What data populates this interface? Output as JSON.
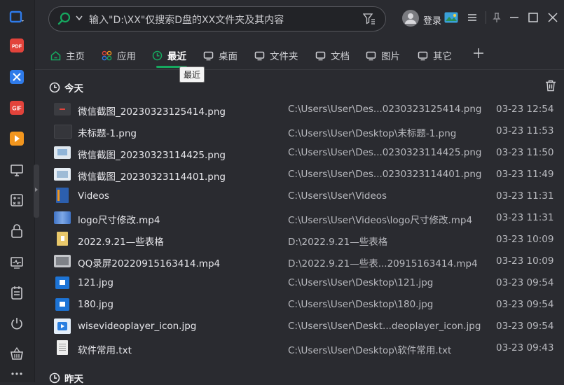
{
  "colors": {
    "accent": "#16a85f",
    "background": "#2a2b30",
    "sidebar": "#26272b"
  },
  "sidebar": {
    "items": [
      {
        "icon": "window-app-icon",
        "color": "#2f7bea"
      },
      {
        "icon": "pdf-icon",
        "color": "#e2433b"
      },
      {
        "icon": "translate-icon",
        "color": "#2f7bea"
      },
      {
        "icon": "gif-icon",
        "color": "#e2433b"
      },
      {
        "icon": "video-play-icon",
        "color": "#f2961e"
      },
      {
        "icon": "monitor-icon",
        "color": "#c8c9cd"
      },
      {
        "icon": "calculator-icon",
        "color": "#c8c9cd"
      },
      {
        "icon": "lock-icon",
        "color": "#c8c9cd"
      },
      {
        "icon": "activity-monitor-icon",
        "color": "#c8c9cd"
      },
      {
        "icon": "clipboard-icon",
        "color": "#c8c9cd"
      },
      {
        "icon": "power-icon",
        "color": "#c8c9cd"
      },
      {
        "icon": "basket-icon",
        "color": "#c8c9cd"
      },
      {
        "icon": "more-icon",
        "color": "#c8c9cd"
      }
    ]
  },
  "search": {
    "placeholder": "输入\"D:\\XX\"仅搜索D盘的XX文件夹及其内容"
  },
  "header": {
    "login_label": "登录"
  },
  "tabs": [
    {
      "label": "主页",
      "icon": "home-icon"
    },
    {
      "label": "应用",
      "icon": "apps-icon"
    },
    {
      "label": "最近",
      "icon": "clock-icon",
      "active": true
    },
    {
      "label": "桌面",
      "icon": "desktop-icon"
    },
    {
      "label": "文件夹",
      "icon": "folder-icon"
    },
    {
      "label": "文档",
      "icon": "document-icon"
    },
    {
      "label": "图片",
      "icon": "image-icon"
    },
    {
      "label": "其它",
      "icon": "other-icon"
    }
  ],
  "tooltip": "最近",
  "sections": {
    "today": "今天",
    "yesterday": "昨天"
  },
  "files": [
    {
      "name": "微信截图_20230323125414.png",
      "path": "C:\\Users\\User\\Des...0230323125414.png",
      "time": "03-23 12:54",
      "thumb": "#3b3c41"
    },
    {
      "name": "未标题-1.png",
      "path": "C:\\Users\\User\\Desktop\\未标题-1.png",
      "time": "03-23 11:53",
      "thumb": "#35363b"
    },
    {
      "name": "微信截图_20230323114425.png",
      "path": "C:\\Users\\User\\Des...0230323114425.png",
      "time": "03-23 11:50",
      "thumb": "#8fb4d8"
    },
    {
      "name": "微信截图_20230323114401.png",
      "path": "C:\\Users\\User\\Des...0230323114401.png",
      "time": "03-23 11:49",
      "thumb": "#9ebbd6"
    },
    {
      "name": "Videos",
      "path": "C:\\Users\\User\\Videos",
      "time": "03-23 11:31",
      "thumb": "#2c5fae"
    },
    {
      "name": "logo尺寸修改.mp4",
      "path": "C:\\Users\\User\\Videos\\logo尺寸修改.mp4",
      "time": "03-23 11:31",
      "thumb": "#3f73c6"
    },
    {
      "name": "2022.9.21—些表格",
      "path": "D:\\2022.9.21—些表格",
      "time": "03-23 10:09",
      "thumb": "#e9c86a"
    },
    {
      "name": "QQ录屏20220915163414.mp4",
      "path": "D:\\2022.9.21—些表...20915163414.mp4",
      "time": "03-23 10:09",
      "thumb": "#7f8288"
    },
    {
      "name": "121.jpg",
      "path": "C:\\Users\\User\\Desktop\\121.jpg",
      "time": "03-23 09:54",
      "thumb": "#1d74d6"
    },
    {
      "name": "180.jpg",
      "path": "C:\\Users\\User\\Desktop\\180.jpg",
      "time": "03-23 09:54",
      "thumb": "#1d74d6"
    },
    {
      "name": "wisevideoplayer_icon.jpg",
      "path": "C:\\Users\\User\\Deskt...deoplayer_icon.jpg",
      "time": "03-23 09:54",
      "thumb": "#2a7fe0"
    },
    {
      "name": "软件常用.txt",
      "path": "C:\\Users\\User\\Desktop\\软件常用.txt",
      "time": "03-23 09:43",
      "thumb": "#eeeeee"
    }
  ]
}
